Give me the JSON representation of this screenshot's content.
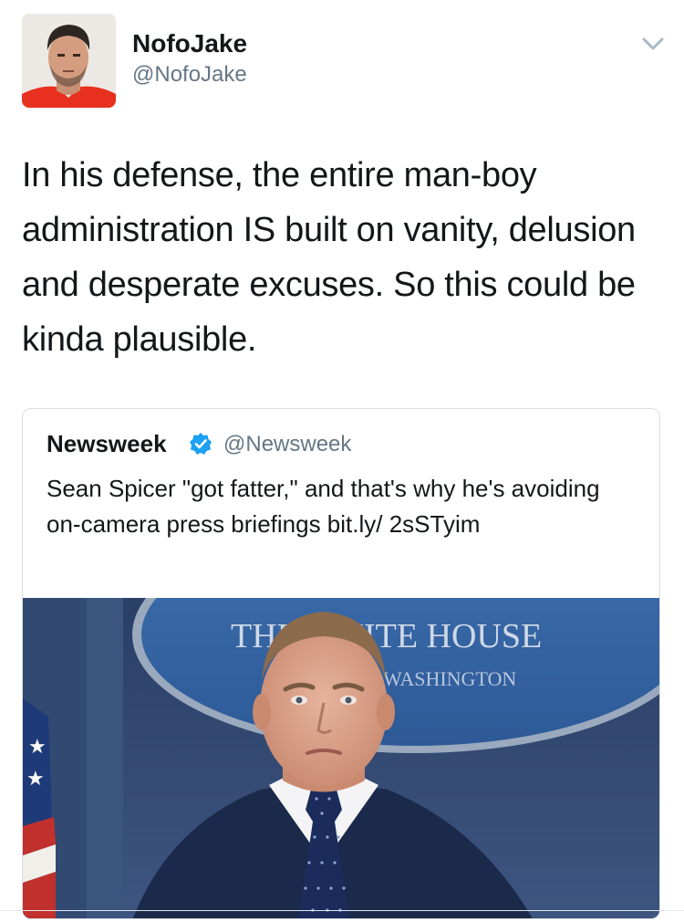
{
  "author": {
    "display_name": "NofoJake",
    "handle": "@NofoJake",
    "avatar_icon": "profile-photo-icon"
  },
  "menu_icon": "chevron-down-icon",
  "tweet": {
    "text": "In his defense, the entire man-boy administration IS built on vanity, delusion and desperate excuses. So this could be kinda plausible."
  },
  "quoted_tweet": {
    "display_name": "Newsweek",
    "verified_icon": "verified-badge-icon",
    "handle": "@Newsweek",
    "text": "Sean Spicer \"got fatter,\" and that's why he's avoiding on-camera press briefings bit.ly/ 2sSTyim",
    "image": {
      "sign_text_line1": "THE WHITE HOUSE",
      "sign_text_line2": "WASHINGTON"
    }
  },
  "colors": {
    "text_primary": "#14171a",
    "text_secondary": "#657786",
    "verified_blue": "#1da1f2",
    "border": "#d8dee3"
  }
}
